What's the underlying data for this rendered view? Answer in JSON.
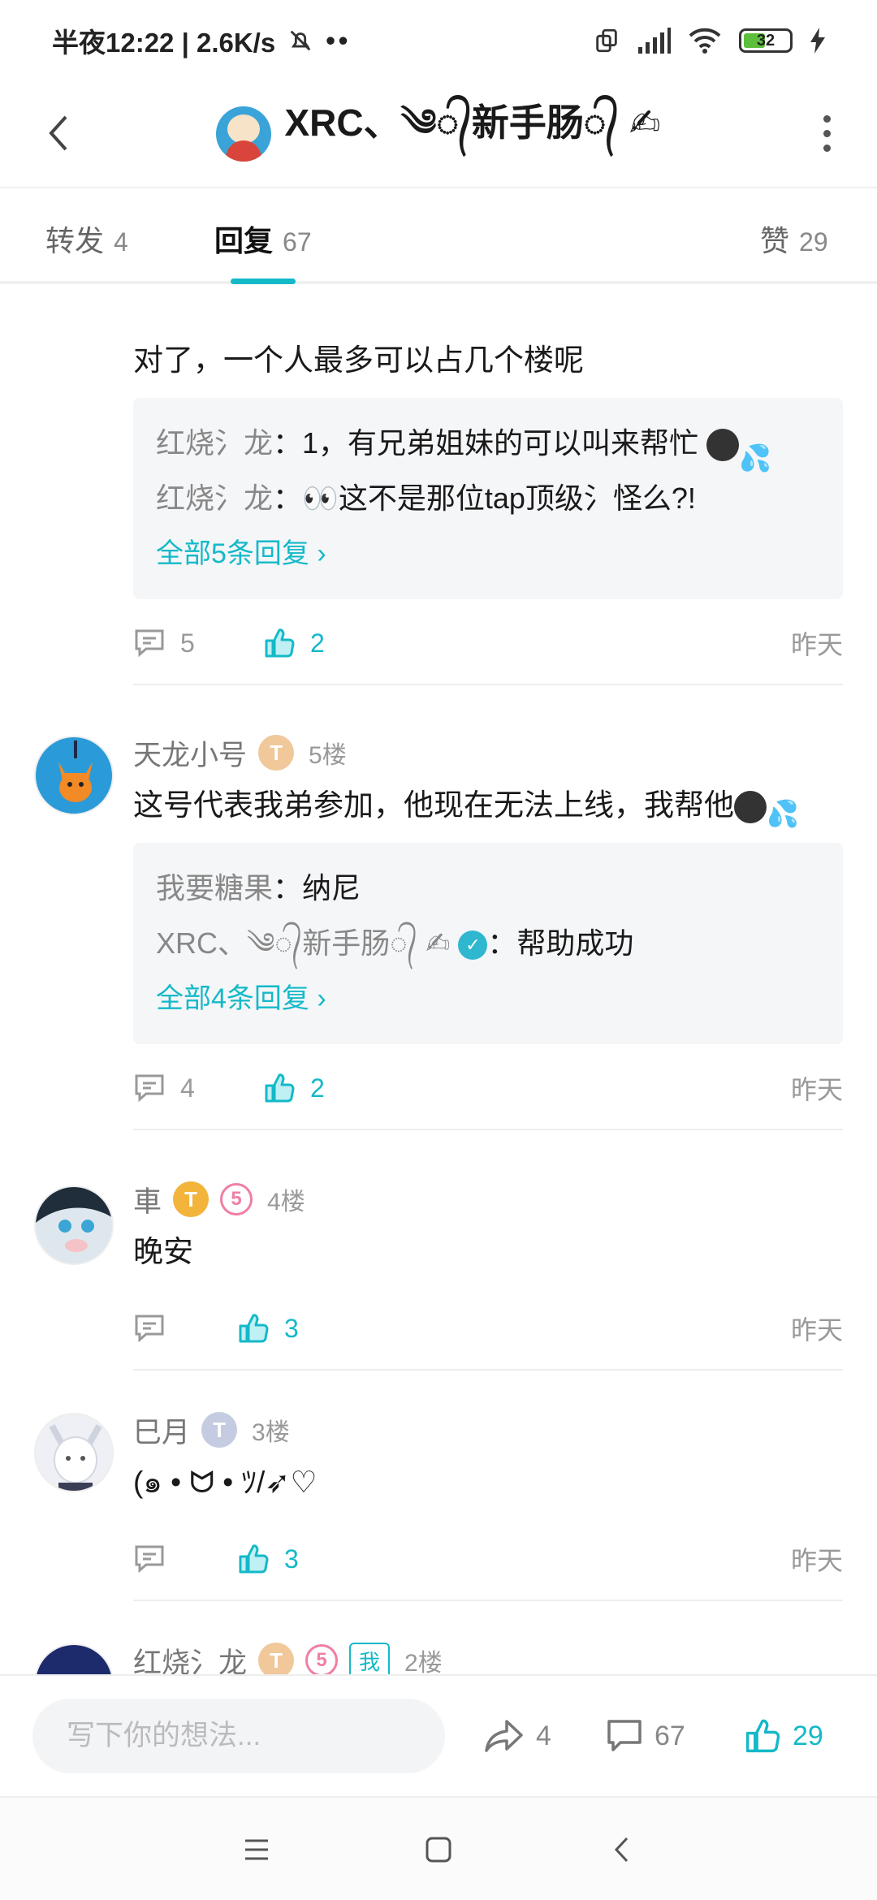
{
  "status": {
    "time": "半夜12:22 | 2.6K/s",
    "battery": "32"
  },
  "header": {
    "title": "XRC、༄᭄新手肠᭄ ✍"
  },
  "tabs": [
    {
      "label": "转发",
      "count": "4"
    },
    {
      "label": "回复",
      "count": "67"
    },
    {
      "label": "赞",
      "count": "29"
    }
  ],
  "comments": [
    {
      "text": "对了，一个人最多可以占几个楼呢",
      "replies": [
        {
          "name": "红烧氵龙",
          "sep": "：",
          "text": "1，有兄弟姐妹的可以叫来帮忙"
        },
        {
          "name": "红烧氵龙",
          "sep": "：",
          "text": "👀这不是那位tap顶级氵怪么?!"
        }
      ],
      "all_replies": "全部5条回复 ›",
      "reply_count": "5",
      "like_count": "2",
      "time": "昨天"
    },
    {
      "name": "天龙小号",
      "level": "T",
      "floor": "5楼",
      "text": "这号代表我弟参加，他现在无法上线，我帮他",
      "replies": [
        {
          "name": "我要糖果",
          "sep": "：",
          "text": "纳尼"
        },
        {
          "name": "XRC、༄᭄新手肠᭄ ✍",
          "sep": "：",
          "text": "帮助成功"
        }
      ],
      "all_replies": "全部4条回复 ›",
      "reply_count": "4",
      "like_count": "2",
      "time": "昨天"
    },
    {
      "name": "車",
      "level": "T",
      "badge": "5",
      "floor": "4楼",
      "text": "晚安",
      "like_count": "3",
      "time": "昨天"
    },
    {
      "name": "巳月",
      "level": "T",
      "floor": "3楼",
      "text": "(๑ • ᗢ • ﾂ/➶♡",
      "like_count": "3",
      "time": "昨天"
    },
    {
      "name": "红烧氵龙",
      "level": "T",
      "badge": "5",
      "me": "我",
      "floor": "2楼"
    }
  ],
  "bottom": {
    "placeholder": "写下你的想法...",
    "share_count": "4",
    "comment_count": "67",
    "like_count": "29"
  },
  "colors": {
    "accent": "#14b9c8",
    "text": "#1a1a1a",
    "muted": "#999999"
  }
}
